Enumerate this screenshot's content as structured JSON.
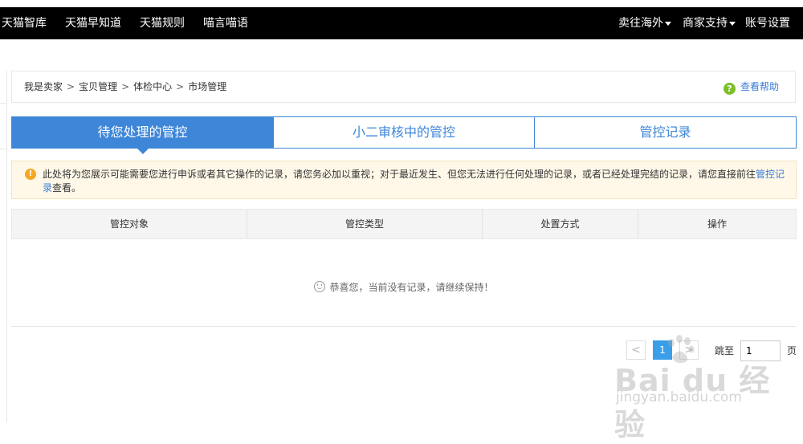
{
  "topnav": {
    "left": [
      "天猫智库",
      "天猫早知道",
      "天猫规则",
      "喵言喵语"
    ],
    "right": [
      {
        "label": "卖往海外",
        "dropdown": true
      },
      {
        "label": "商家支持",
        "dropdown": true
      },
      {
        "label": "账号设置",
        "dropdown": false
      }
    ]
  },
  "breadcrumb": {
    "items": [
      "我是卖家",
      "宝贝管理",
      "体检中心",
      "市场管理"
    ],
    "separator": ">",
    "help_label": "查看帮助",
    "help_icon": "question-circle-icon"
  },
  "tabs": [
    {
      "label": "待您处理的管控",
      "active": true
    },
    {
      "label": "小二审核中的管控",
      "active": false
    },
    {
      "label": "管控记录",
      "active": false
    }
  ],
  "notice": {
    "icon": "warning-icon",
    "text": "此处将为您展示可能需要您进行申诉或者其它操作的记录，请您务必加以重视；对于最近发生、但您无法进行任何处理的记录，或者已经处理完结的记录，请您直接前往",
    "link": "管控记录",
    "suffix": "查看。"
  },
  "table": {
    "headers": [
      "管控对象",
      "管控类型",
      "处置方式",
      "操作"
    ]
  },
  "empty_state": {
    "icon": "smile-icon",
    "text": "恭喜您，当前没有记录，请继续保持！"
  },
  "pagination": {
    "prev": "<",
    "current": "1",
    "next": ">",
    "jump_label": "跳至",
    "jump_value": "1",
    "page_unit": "页"
  },
  "watermark": {
    "logo": "Bai du 经验",
    "url": "jingyan.baidu.com"
  },
  "colors": {
    "topbar_bg": "#000000",
    "accent_blue": "#3d86d8",
    "help_green": "#7bbf2a",
    "warning_orange": "#f5a623",
    "notice_bg": "#fff8e8"
  }
}
